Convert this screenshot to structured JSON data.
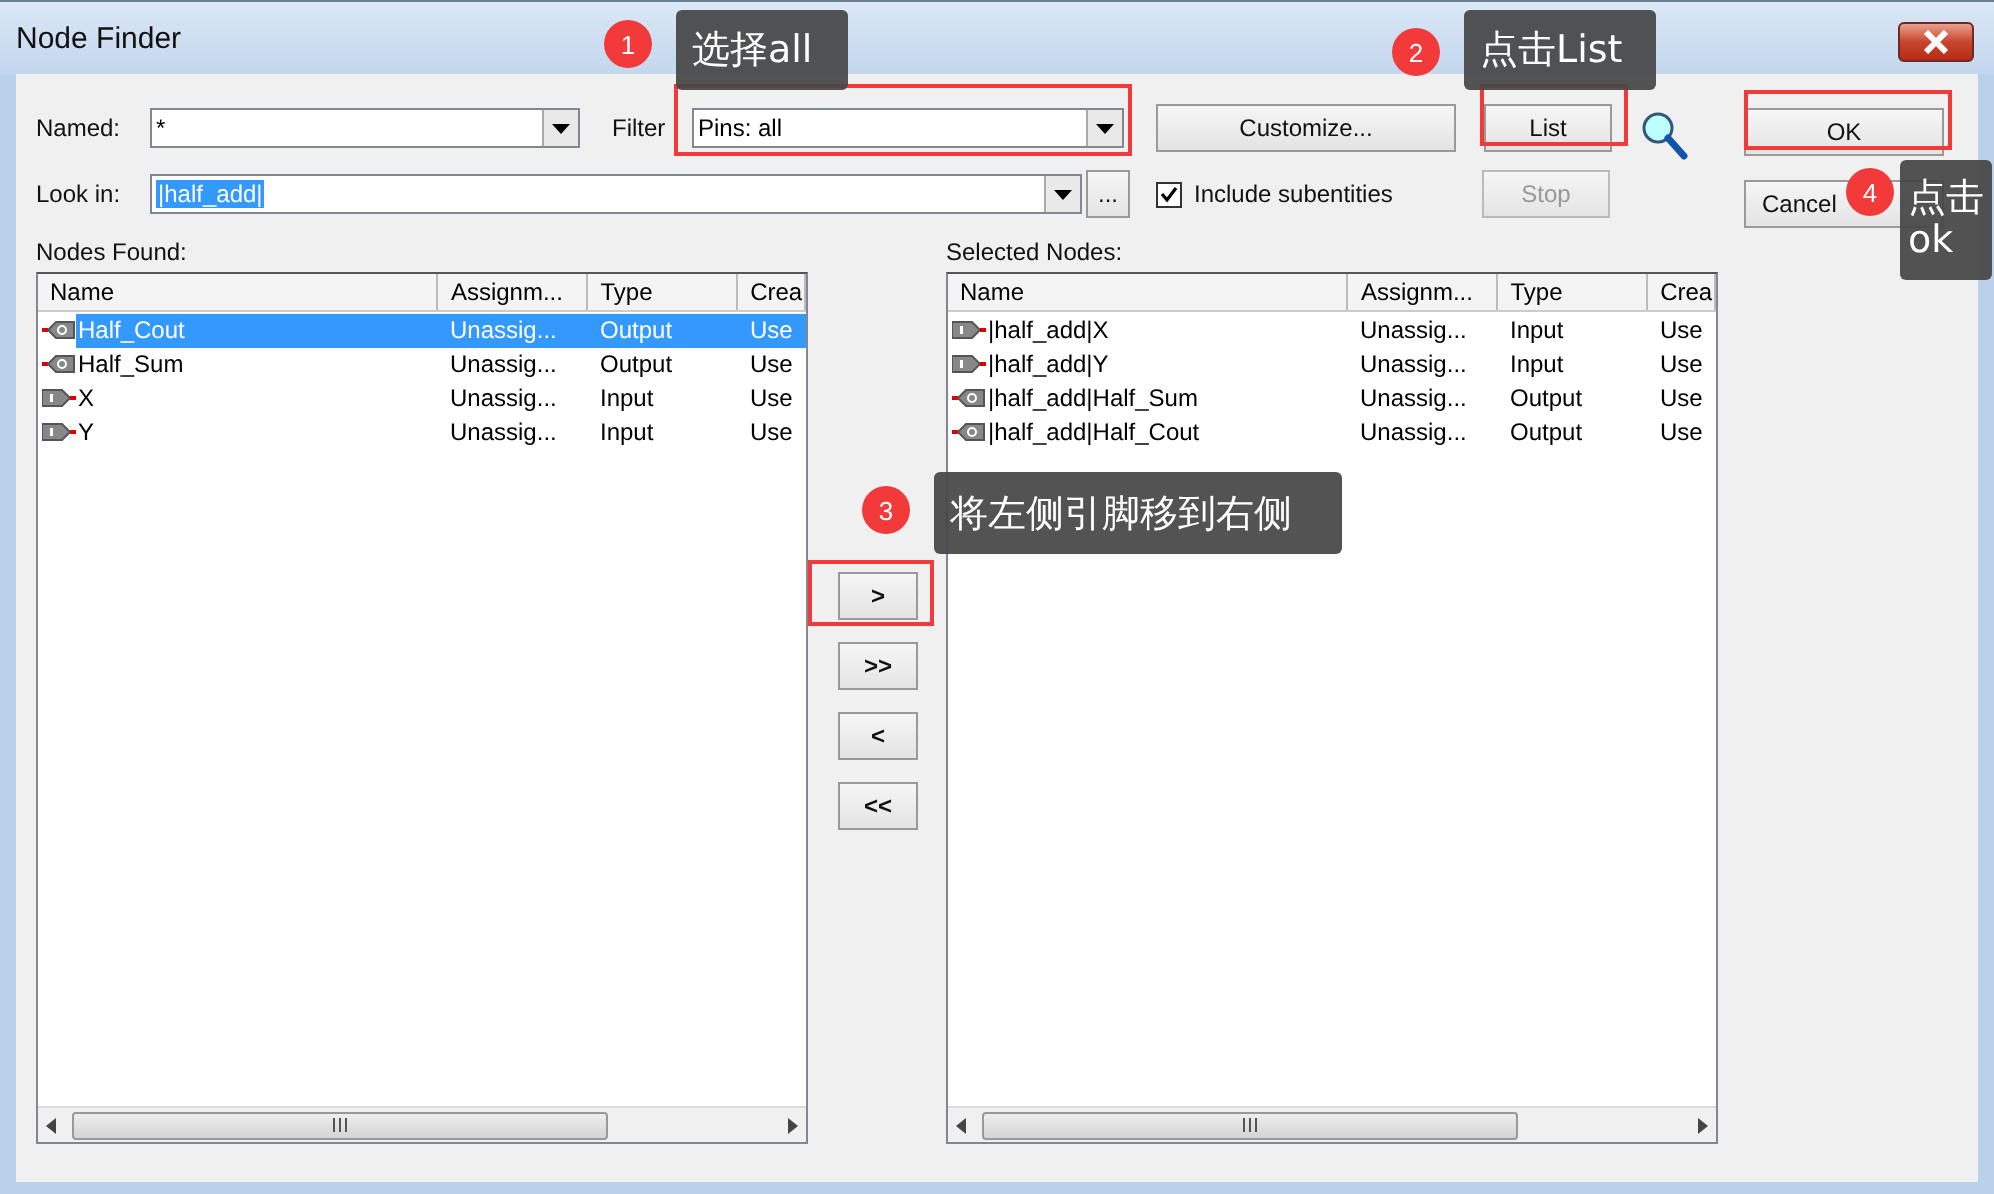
{
  "window": {
    "title": "Node Finder"
  },
  "named": {
    "label": "Named:",
    "value": "*"
  },
  "filter": {
    "label": "Filter",
    "value": "Pins: all"
  },
  "look_in": {
    "label": "Look in:",
    "value": "|half_add|"
  },
  "browse_button": "...",
  "include_subentities": {
    "label": "Include subentities",
    "checked": true
  },
  "buttons": [
    {
      "label": "Customize...",
      "kind": "customize",
      "disabled": false
    },
    {
      "label": "List",
      "kind": "list",
      "disabled": false
    },
    {
      "label": "OK",
      "kind": "ok",
      "disabled": false
    },
    {
      "label": "Stop",
      "kind": "stop",
      "disabled": true
    },
    {
      "label": "Cancel",
      "kind": "cancel",
      "disabled": false
    }
  ],
  "nodes_found": {
    "label": "Nodes Found:",
    "columns": [
      "Name",
      "Assignm...",
      "Type",
      "Crea"
    ],
    "rows": [
      {
        "kind": "output",
        "name": "Half_Cout",
        "assignment": "Unassig...",
        "type": "Output",
        "column_4": "Use",
        "selected": true
      },
      {
        "kind": "output",
        "name": "Half_Sum",
        "assignment": "Unassig...",
        "type": "Output",
        "column_4": "Use",
        "selected": false
      },
      {
        "kind": "input",
        "name": "X",
        "assignment": "Unassig...",
        "type": "Input",
        "column_4": "Use",
        "selected": false
      },
      {
        "kind": "input",
        "name": "Y",
        "assignment": "Unassig...",
        "type": "Input",
        "column_4": "Use",
        "selected": false
      }
    ]
  },
  "selected_nodes": {
    "label": "Selected Nodes:",
    "columns": [
      "Name",
      "Assignm...",
      "Type",
      "Crea"
    ],
    "rows": [
      {
        "kind": "input",
        "name": "|half_add|X",
        "assignment": "Unassig...",
        "type": "Input",
        "column_4": "Use",
        "selected": false
      },
      {
        "kind": "input",
        "name": "|half_add|Y",
        "assignment": "Unassig...",
        "type": "Input",
        "column_4": "Use",
        "selected": false
      },
      {
        "kind": "output",
        "name": "|half_add|Half_Sum",
        "assignment": "Unassig...",
        "type": "Output",
        "column_4": "Use",
        "selected": false
      },
      {
        "kind": "output",
        "name": "|half_add|Half_Cout",
        "assignment": "Unassig...",
        "type": "Output",
        "column_4": "Use",
        "selected": false
      }
    ]
  },
  "move_buttons": [
    ">",
    ">>",
    "<",
    "<<"
  ],
  "annotations": [
    {
      "number": "1",
      "text": "选择all"
    },
    {
      "number": "2",
      "text": "点击List"
    },
    {
      "number": "3",
      "text": "将左侧引脚移到右侧"
    },
    {
      "number": "4",
      "text": "点击ok"
    }
  ]
}
